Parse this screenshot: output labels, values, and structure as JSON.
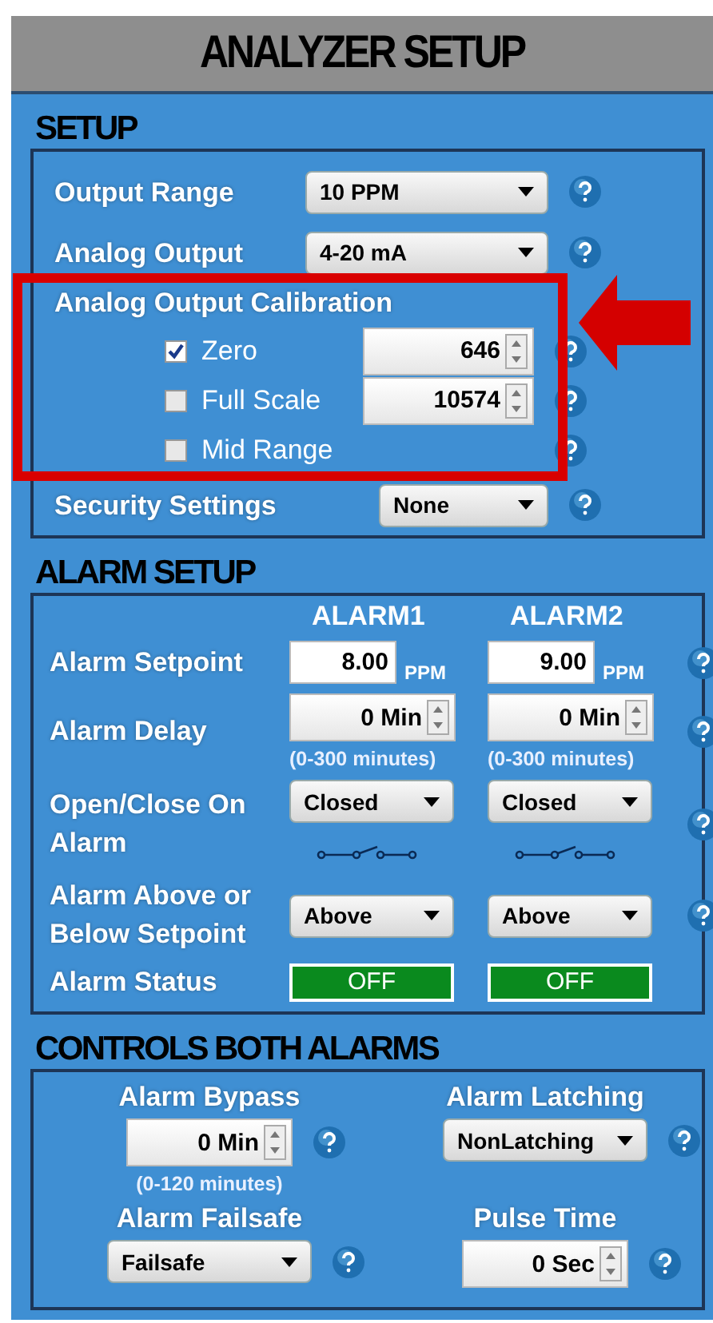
{
  "title": "ANALYZER SETUP",
  "setup": {
    "heading": "SETUP",
    "rows": [
      {
        "label": "Output Range",
        "value": "10 PPM"
      },
      {
        "label": "Analog Output",
        "value": "4-20 mA"
      }
    ],
    "calibration": {
      "label": "Analog Output Calibration",
      "highlighted": true,
      "items": [
        {
          "label": "Zero",
          "checked": true,
          "value": "646"
        },
        {
          "label": "Full Scale",
          "checked": false,
          "value": "10574"
        },
        {
          "label": "Mid Range",
          "checked": false
        }
      ]
    },
    "security": {
      "label": "Security Settings",
      "value": "None"
    }
  },
  "alarm_setup": {
    "heading": "ALARM SETUP",
    "columns": [
      "ALARM1",
      "ALARM2"
    ],
    "rows": [
      {
        "kind": "number",
        "label": "Alarm Setpoint",
        "cells": [
          {
            "value": "8.00",
            "unit": "PPM"
          },
          {
            "value": "9.00",
            "unit": "PPM"
          }
        ]
      },
      {
        "kind": "spinner",
        "label": "Alarm Delay",
        "cells": [
          {
            "value": "0 Min",
            "hint": "(0-300 minutes)"
          },
          {
            "value": "0 Min",
            "hint": "(0-300 minutes)"
          }
        ]
      },
      {
        "kind": "contact",
        "label": "Open/Close On Alarm",
        "cells": [
          {
            "value": "Closed"
          },
          {
            "value": "Closed"
          }
        ]
      },
      {
        "kind": "select",
        "label": "Alarm Above or Below Setpoint",
        "cells": [
          {
            "value": "Above"
          },
          {
            "value": "Above"
          }
        ]
      },
      {
        "kind": "status",
        "label": "Alarm Status",
        "cells": [
          {
            "value": "OFF"
          },
          {
            "value": "OFF"
          }
        ]
      }
    ]
  },
  "controls": {
    "heading": "CONTROLS BOTH ALARMS",
    "items": [
      {
        "kind": "spinner",
        "label": "Alarm Bypass",
        "value": "0 Min",
        "hint": "(0-120 minutes)"
      },
      {
        "kind": "select",
        "label": "Alarm Latching",
        "value": "NonLatching"
      },
      {
        "kind": "select",
        "label": "Alarm Failsafe",
        "value": "Failsafe"
      },
      {
        "kind": "spinner",
        "label": "Pulse Time",
        "value": "0 Sec"
      }
    ]
  }
}
